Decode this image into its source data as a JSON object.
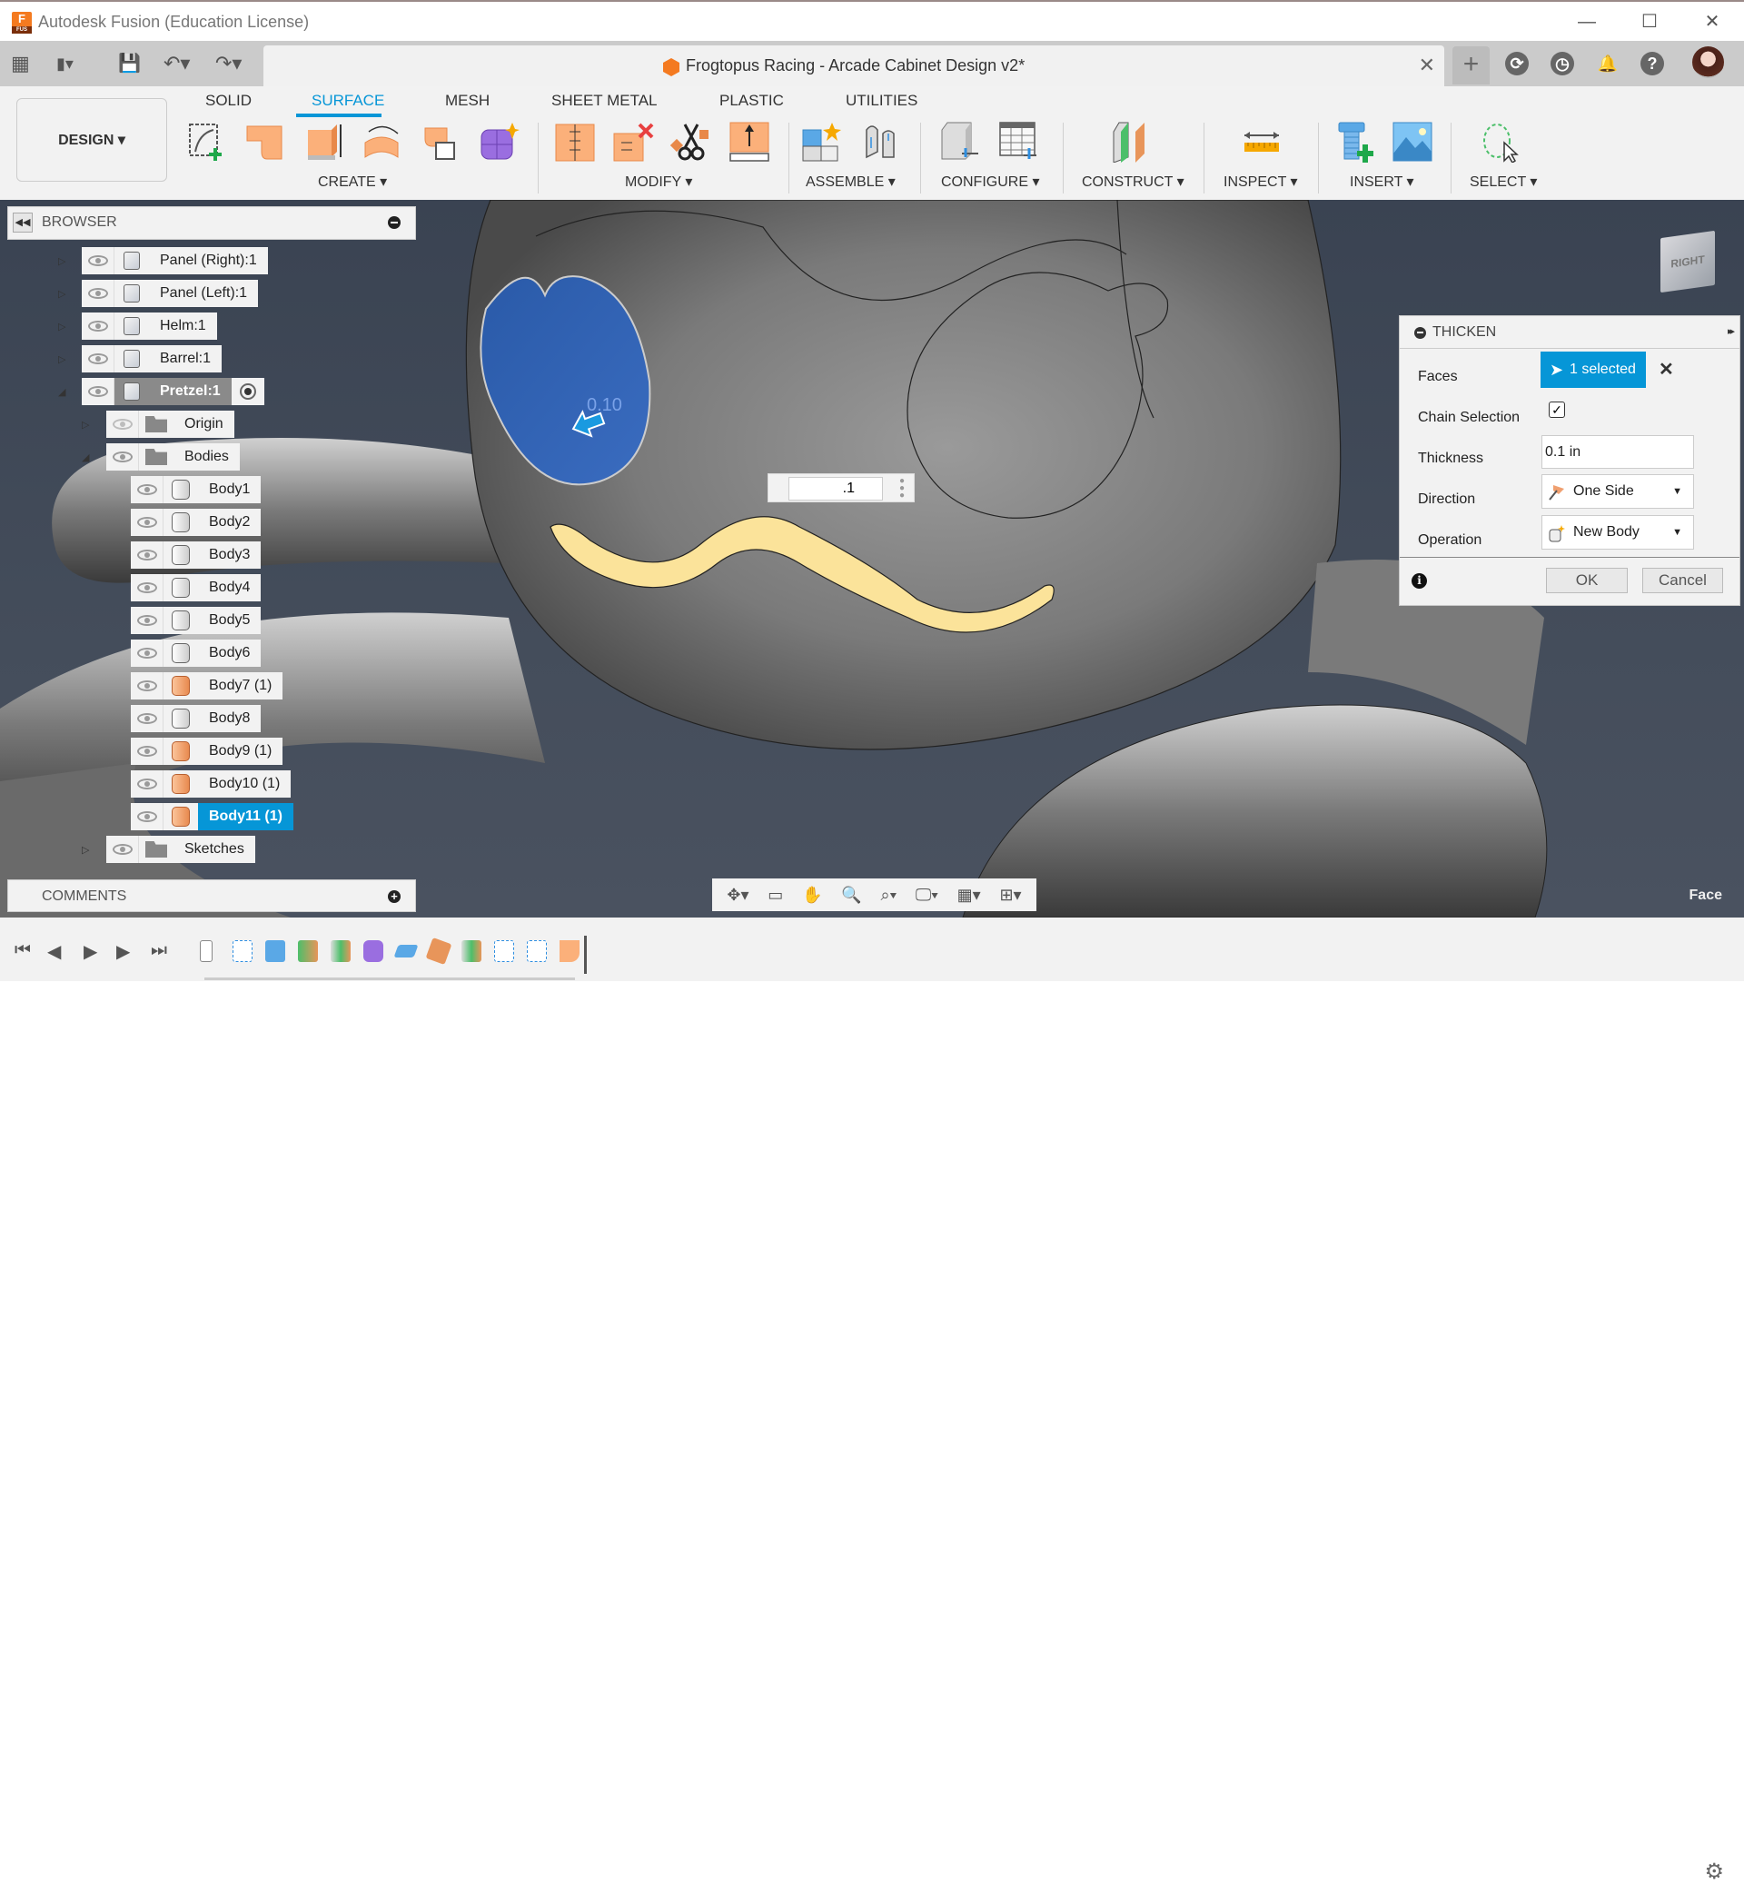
{
  "window": {
    "app_title": "Autodesk Fusion (Education License)",
    "logo_letter": "F",
    "logo_sub": "FUS",
    "minimize": "—",
    "maximize": "☐",
    "close": "✕"
  },
  "qat": {
    "grid_icon": "▦",
    "file_icon": "▮▾",
    "save_icon": "💾",
    "undo_icon": "↶▾",
    "redo_icon": "↷▾"
  },
  "document": {
    "title": "Frogtopus Racing - Arcade Cabinet Design v2*",
    "close": "✕",
    "new_tab": "+"
  },
  "right_icons": {
    "extensions": "⟳",
    "job_status": "◷",
    "notifications": "🔔",
    "help": "?"
  },
  "ribbon": {
    "workspace": "DESIGN ▾",
    "tabs": [
      {
        "label": "SOLID",
        "active": false
      },
      {
        "label": "SURFACE",
        "active": true
      },
      {
        "label": "MESH",
        "active": false
      },
      {
        "label": "SHEET METAL",
        "active": false
      },
      {
        "label": "PLASTIC",
        "active": false
      },
      {
        "label": "UTILITIES",
        "active": false
      }
    ],
    "groups": [
      {
        "label": "CREATE ▾"
      },
      {
        "label": "MODIFY ▾"
      },
      {
        "label": "ASSEMBLE ▾"
      },
      {
        "label": "CONFIGURE ▾"
      },
      {
        "label": "CONSTRUCT ▾"
      },
      {
        "label": "INSPECT ▾"
      },
      {
        "label": "INSERT ▾"
      },
      {
        "label": "SELECT ▾"
      }
    ]
  },
  "browser": {
    "title": "BROWSER",
    "items": [
      {
        "label": "Panel (Right):1",
        "type": "component"
      },
      {
        "label": "Panel (Left):1",
        "type": "component"
      },
      {
        "label": "Helm:1",
        "type": "component"
      },
      {
        "label": "Barrel:1",
        "type": "component"
      },
      {
        "label": "Pretzel:1",
        "type": "component",
        "active": true,
        "expanded": true
      },
      {
        "label": "Origin",
        "type": "folder",
        "hidden": true
      },
      {
        "label": "Bodies",
        "type": "folder",
        "expanded": true
      },
      {
        "label": "Body1",
        "type": "body"
      },
      {
        "label": "Body2",
        "type": "body"
      },
      {
        "label": "Body3",
        "type": "body"
      },
      {
        "label": "Body4",
        "type": "body"
      },
      {
        "label": "Body5",
        "type": "body"
      },
      {
        "label": "Body6",
        "type": "body"
      },
      {
        "label": "Body7 (1)",
        "type": "surface"
      },
      {
        "label": "Body8",
        "type": "body"
      },
      {
        "label": "Body9 (1)",
        "type": "surface"
      },
      {
        "label": "Body10 (1)",
        "type": "surface"
      },
      {
        "label": "Body11 (1)",
        "type": "surface",
        "selected": true
      },
      {
        "label": "Sketches",
        "type": "folder"
      }
    ]
  },
  "comments": {
    "title": "COMMENTS",
    "add": "+"
  },
  "thicken": {
    "title": "THICKEN",
    "expand": "▸▸",
    "faces_label": "Faces",
    "faces_value": "1 selected",
    "faces_clear": "✕",
    "chain_label": "Chain Selection",
    "chain_checked": "✓",
    "thickness_label": "Thickness",
    "thickness_value": "0.1 in",
    "direction_label": "Direction",
    "direction_value": "One Side",
    "operation_label": "Operation",
    "operation_value": "New Body",
    "info": "i",
    "ok": "OK",
    "cancel": "Cancel"
  },
  "viewport": {
    "dimension_label": "0.10",
    "value_input": ".1",
    "viewcube_face": "RIGHT",
    "selection_filter": "Face",
    "colors": {
      "selected_face": "#2f5fb0",
      "highlight": "#fbe39a"
    }
  },
  "timeline": {
    "first": "⏮",
    "prev": "◀",
    "play": "▶",
    "next": "▶",
    "last": "⏭",
    "settings": "⚙"
  }
}
